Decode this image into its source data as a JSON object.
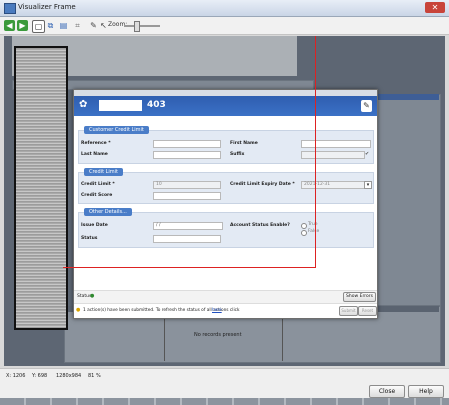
{
  "window": {
    "title": "Visualizer Frame",
    "close_glyph": "✕"
  },
  "toolbar": {
    "zoom_label": "Zoom:"
  },
  "status_bar": {
    "x": "X: 1206",
    "y": "Y: 698",
    "size": "1280x984",
    "zoom": "81 %"
  },
  "buttons": {
    "close": "Close",
    "help": "Help"
  },
  "dialog": {
    "record_number": "403",
    "sections": {
      "customer": "Customer Credit Limit",
      "credit": "Credit Limit",
      "other": "Other Details..."
    },
    "labels": {
      "reference": "Reference *",
      "first_name": "First Name",
      "last_name": "Last Name",
      "suffix": "Suffix",
      "credit_limit": "Credit Limit *",
      "credit_limit_expiry": "Credit Limit Expiry Date *",
      "credit_score": "Credit Score",
      "issue_date": "Issue Date",
      "account_status_enable": "Account Status Enable?",
      "status": "Status"
    },
    "values": {
      "credit_limit": "10",
      "expiry": "2021-12-31",
      "issue_date": "/ /"
    },
    "radio": {
      "true": "True",
      "false": "False"
    },
    "status_label": "Status",
    "show_errors": "Show Errors",
    "message": "1 action(s) have been submitted. To refresh the status of all actions click",
    "message_link": "here",
    "submit": "Submit",
    "reset": "Reset"
  },
  "background": {
    "no_records": "No records present"
  }
}
